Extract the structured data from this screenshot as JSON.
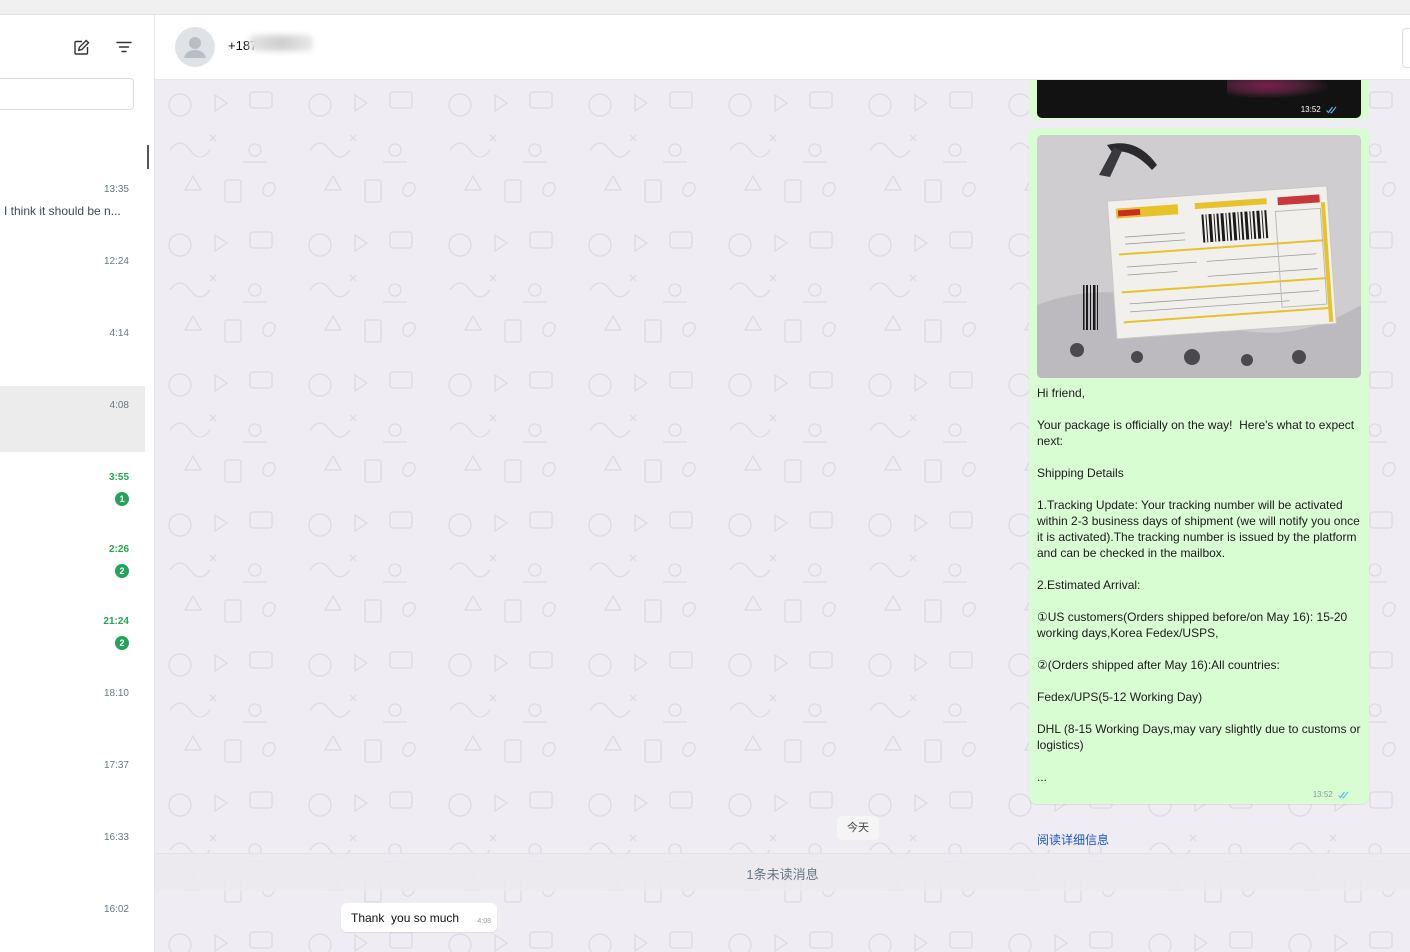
{
  "sidebar": {
    "new_chat_icon": "edit-icon",
    "filter_icon": "filter-icon",
    "search_value": "",
    "chats": [
      {
        "time": "13:35",
        "preview": "I think it should be n...",
        "unread": false,
        "badge": ""
      },
      {
        "time": "12:24",
        "preview": "",
        "unread": false,
        "badge": ""
      },
      {
        "time": "4:14",
        "preview": "",
        "unread": false,
        "badge": ""
      },
      {
        "time": "4:08",
        "preview": "",
        "unread": false,
        "badge": "",
        "active": true
      },
      {
        "time": "3:55",
        "preview": "",
        "unread": true,
        "badge": "1"
      },
      {
        "time": "2:26",
        "preview": "",
        "unread": true,
        "badge": "2"
      },
      {
        "time": "21:24",
        "preview": "",
        "unread": true,
        "badge": "2"
      },
      {
        "time": "18:10",
        "preview": "",
        "unread": false,
        "badge": ""
      },
      {
        "time": "17:37",
        "preview": "",
        "unread": false,
        "badge": ""
      },
      {
        "time": "16:33",
        "preview": "",
        "unread": false,
        "badge": ""
      },
      {
        "time": "16:02",
        "preview": "",
        "unread": false,
        "badge": ""
      }
    ]
  },
  "header": {
    "contact_name": "+187"
  },
  "messages": {
    "image_top_time": "13:52",
    "outgoing_text": "Hi friend,\n\nYour package is officially on the way!  Here's what to expect next:\n\nShipping Details\n\n1.Tracking Update: Your tracking number will be activated within 2-3 business days of shipment (we will notify you once it is activated).The tracking number is issued by the platform and can be checked in the mailbox.\n\n2.Estimated Arrival:\n\n①US customers(Orders shipped before/on May 16): 15-20 working days,Korea Fedex/USPS,\n\n②(Orders shipped after May 16):All countries:\n\nFedex/UPS(5-12 Working Day)\n\nDHL (8-15 Working Days,may vary slightly due to customs or logistics)\n\n...",
    "read_more": "阅读详细信息",
    "outgoing_time": "13:52",
    "date_divider": "今天",
    "unread_divider": "1条未读消息",
    "incoming_text": "Thank  you so much",
    "incoming_time": "4:08"
  },
  "colors": {
    "outgoing_bubble": "#d9fdd3",
    "chat_background": "#efedf3",
    "unread_green": "#1fa855",
    "link_blue": "#1a57c4"
  }
}
